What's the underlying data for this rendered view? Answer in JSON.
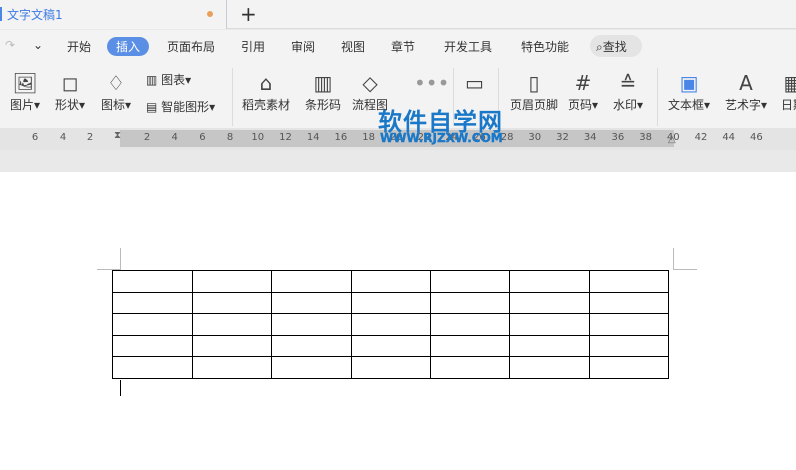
{
  "title_bar": {
    "doc_name": "文字文稿1",
    "new_tab": "+"
  },
  "menu": {
    "items": [
      "开始",
      "插入",
      "页面布局",
      "引用",
      "审阅",
      "视图",
      "章节",
      "开发工具",
      "特色功能"
    ],
    "active": "插入",
    "search": "查找"
  },
  "toolbar": {
    "picture": "图片",
    "shape": "形状",
    "icon": "图标",
    "chart": "图表",
    "smart_art": "智能图形",
    "stock": "稻壳素材",
    "barcode": "条形码",
    "flowchart": "流程图",
    "header_footer": "页眉页脚",
    "page_number": "页码",
    "watermark": "水印",
    "textbox": "文本框",
    "wordart": "艺术字",
    "date": "日期"
  },
  "ruler": {
    "left": [
      "6",
      "4",
      "2"
    ],
    "right": [
      "2",
      "4",
      "6",
      "8",
      "10",
      "12",
      "14",
      "16",
      "18",
      "20",
      "22",
      "24",
      "26",
      "28",
      "30",
      "32",
      "34",
      "36",
      "38",
      "40",
      "42",
      "44",
      "46"
    ]
  },
  "watermark": {
    "title": "软件自学网",
    "url": "WWW.RJZXW.COM"
  },
  "table": {
    "rows": 5,
    "cols": 7
  }
}
